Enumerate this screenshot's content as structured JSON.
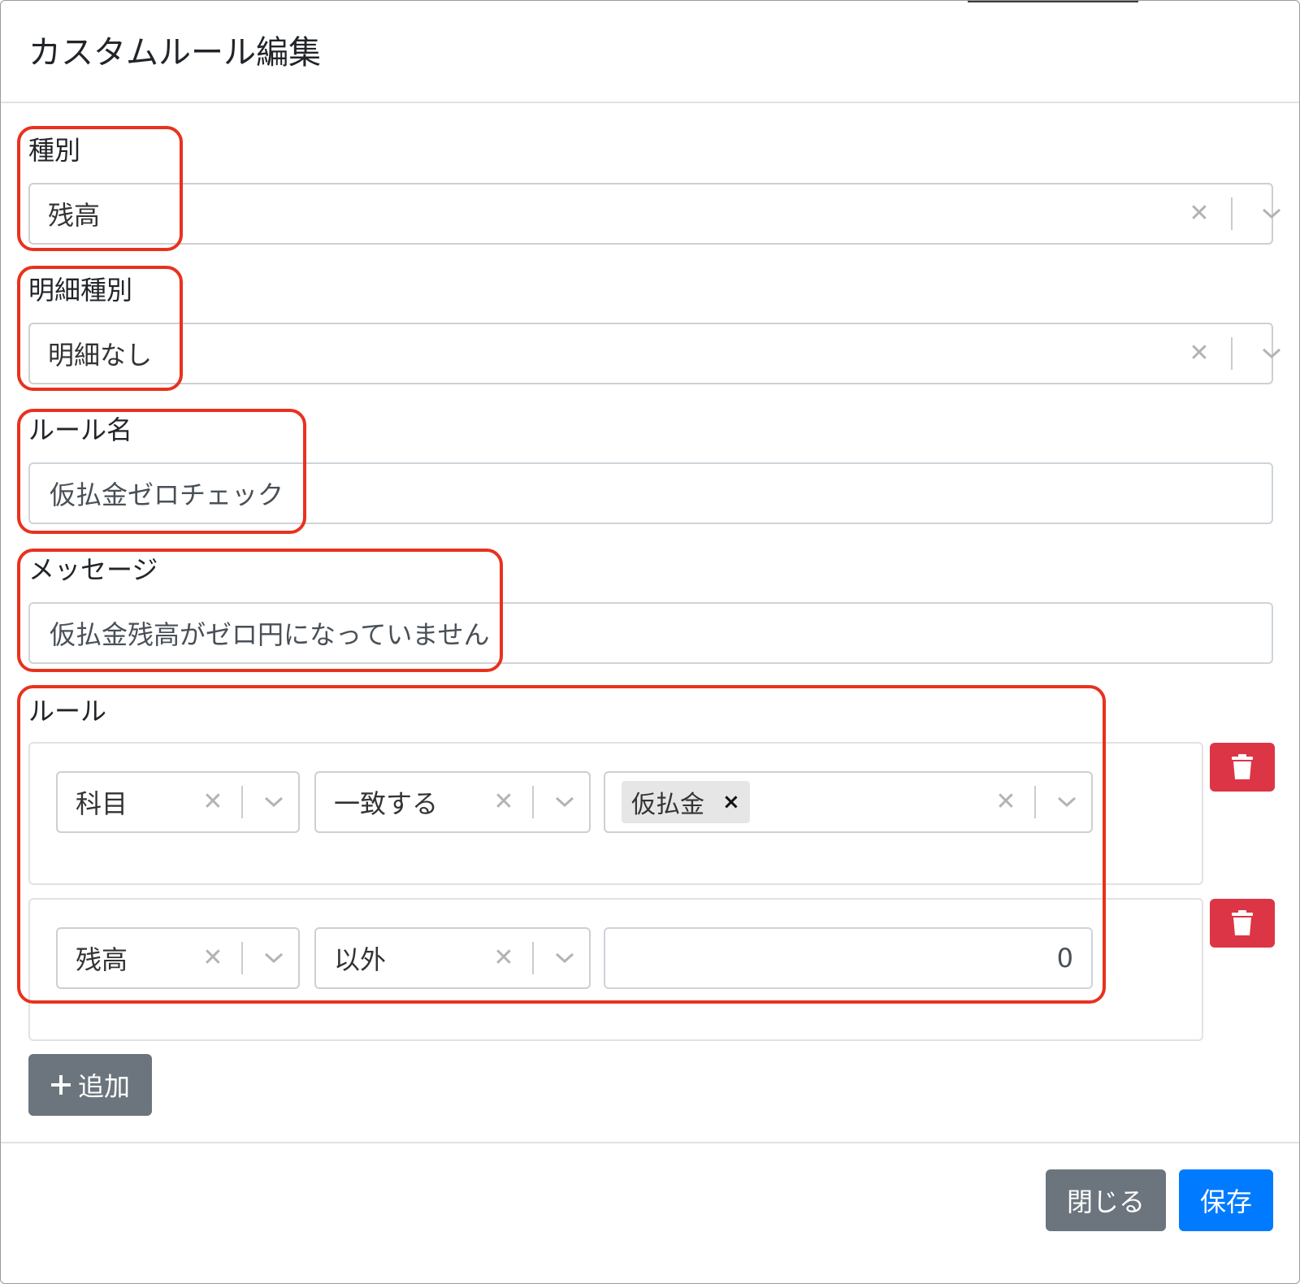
{
  "modal": {
    "title": "カスタムルール編集"
  },
  "type_field": {
    "label": "種別",
    "value": "残高"
  },
  "detail_type_field": {
    "label": "明細種別",
    "value": "明細なし"
  },
  "rule_name_field": {
    "label": "ルール名",
    "value": "仮払金ゼロチェック"
  },
  "message_field": {
    "label": "メッセージ",
    "value": "仮払金残高がゼロ円になっていません"
  },
  "rules": {
    "label": "ルール",
    "rows": [
      {
        "field": "科目",
        "operator": "一致する",
        "tags": [
          "仮払金"
        ]
      },
      {
        "field": "残高",
        "operator": "以外",
        "value": "0"
      }
    ],
    "add_label": "追加"
  },
  "footer": {
    "close_label": "閉じる",
    "save_label": "保存"
  },
  "colors": {
    "primary": "#007bff",
    "secondary": "#6c757d",
    "danger": "#dc3545",
    "highlight": "#e8321e"
  },
  "icons": {
    "clear": "x-icon",
    "dropdown": "chevron-down-icon",
    "delete": "trash-icon",
    "add": "plus-icon"
  }
}
